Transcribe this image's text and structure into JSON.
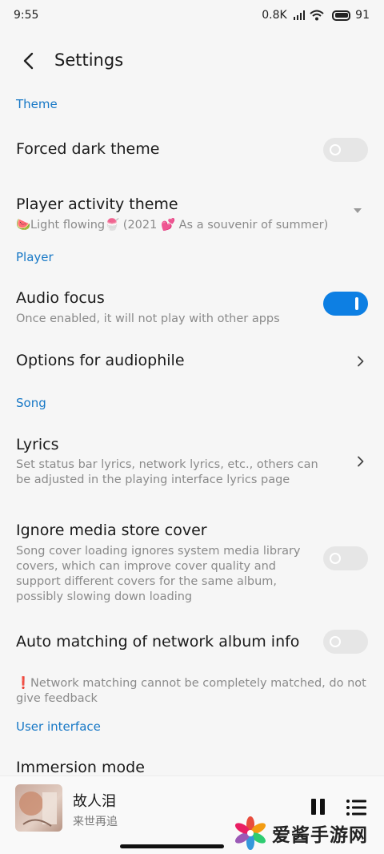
{
  "status_bar": {
    "time": "9:55",
    "net_speed": "0.8K",
    "battery": "91"
  },
  "header": {
    "title": "Settings"
  },
  "sections": {
    "theme": "Theme",
    "player": "Player",
    "song": "Song",
    "ui": "User interface"
  },
  "items": {
    "forced_dark": {
      "title": "Forced dark theme",
      "enabled": false
    },
    "player_activity": {
      "title": "Player activity theme",
      "value": "🍉Light flowing🍧 (2021 💕 As a souvenir of summer)"
    },
    "audio_focus": {
      "title": "Audio focus",
      "subtitle": "Once enabled, it will not play with other apps",
      "enabled": true
    },
    "audiophile": {
      "title": "Options for audiophile"
    },
    "lyrics": {
      "title": "Lyrics",
      "subtitle": "Set status bar lyrics, network lyrics, etc., others can be adjusted in the playing interface lyrics page"
    },
    "ignore_cover": {
      "title": "Ignore media store cover",
      "subtitle": "Song cover loading ignores system media library covers, which can improve cover quality and support different covers for the same album, possibly slowing down loading",
      "enabled": false
    },
    "auto_matching": {
      "title": "Auto matching of network album info",
      "enabled": false,
      "note": "❗Network matching cannot be completely matched, do not give feedback"
    },
    "immersion": {
      "title": "Immersion mode"
    }
  },
  "player": {
    "song_title": "故人泪",
    "artist": "来世再追"
  },
  "watermark": {
    "text": "爱酱手游网"
  },
  "colors": {
    "accent": "#1778c6",
    "toggle_on": "#0d7fe3",
    "toggle_off": "#e6e6e6"
  }
}
